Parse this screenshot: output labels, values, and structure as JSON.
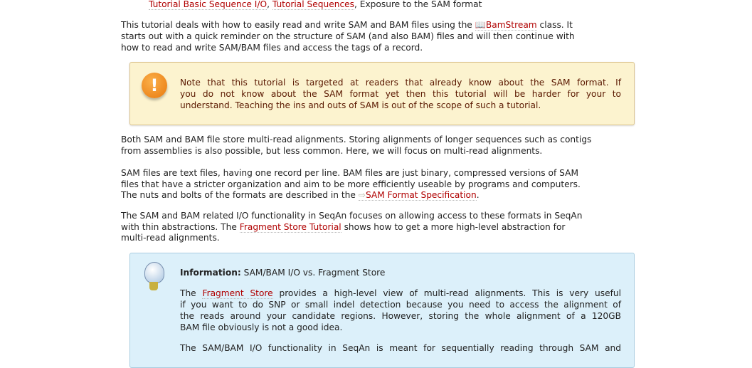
{
  "prereq": {
    "links": [
      "Tutorial Basic Sequence I/O",
      "Tutorial Sequences"
    ],
    "sep": ", ",
    "rest": ", Exposure to the SAM format"
  },
  "intro": {
    "l1a": "This tutorial deals with how to easily read and write SAM and BAM files using the ",
    "link": "BamStream",
    "l1b": " class. It",
    "l2": "starts out with a quick reminder on the structure of SAM (and also BAM) files and will then continue with",
    "l3": "how to read and write SAM/BAM files and access the tags of a record."
  },
  "note": {
    "icon": "warning-icon",
    "color": "#f08c1c",
    "lines": [
      "Note that this tutorial is targeted at readers that already know about the SAM format. If",
      "you do not know about the SAM format yet then this tutorial will be harder for your to",
      "understand. Teaching the ins and outs of SAM is out of the scope of such a tutorial."
    ]
  },
  "p2": [
    "Both SAM and BAM file store multi-read alignments. Storing alignments of longer sequences such as contigs",
    "from assemblies is also possible, but less common. Here, we will focus on multi-read alignments."
  ],
  "p3": {
    "l1": "SAM files are text files, having one record per line. BAM files are just binary, compressed versions of SAM",
    "l2": "files that have a stricter organization and aim to be more efficiently useable by programs and computers.",
    "l3a": "The nuts and bolts of the formats are described in the ",
    "link": "SAM Format Specification",
    "l3b": "."
  },
  "p4": {
    "l1": "The SAM and BAM related I/O functionality in SeqAn focuses on allowing access to these formats in SeqAn",
    "l2a": "with thin abstractions. The ",
    "link": "Fragment Store Tutorial",
    "l2b": " shows how to get a more high-level abstraction for",
    "l3": "multi-read alignments."
  },
  "info": {
    "icon": "lightbulb-icon",
    "label": "Information:",
    "title": " SAM/BAM I/O vs. Fragment Store",
    "l1a": "The ",
    "link": "Fragment Store",
    "l1b": " provides a high-level view of multi-read alignments. This is very useful",
    "l2": "if you want to do SNP or small indel detection because you need to access the alignment of",
    "l3": "the reads around your candidate regions. However, storing the whole alignment of a 120GB",
    "l4": "BAM file obviously is not a good idea.",
    "l5": "The SAM/BAM I/O functionality in SeqAn is meant for sequentially reading through SAM and"
  }
}
